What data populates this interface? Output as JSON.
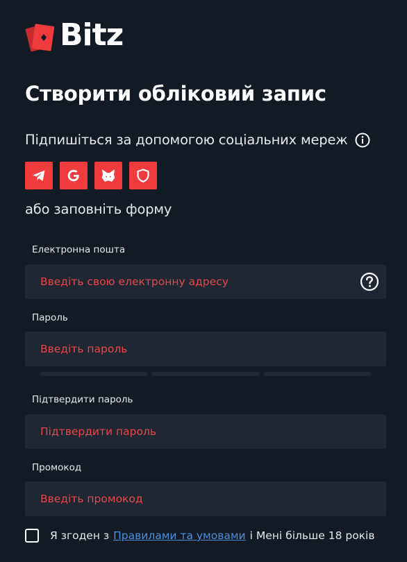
{
  "brand": {
    "name": "Bitz",
    "accent": "#ef3a3e",
    "background": "#121a23",
    "input_background": "#1f2733",
    "placeholder_color": "#e8454a",
    "link_color": "#4a90e2"
  },
  "page": {
    "title": "Створити обліковий запис",
    "social_label": "Підпишіться за допомогою соціальних мереж",
    "or_label": "або заповніть форму"
  },
  "social": [
    {
      "icon": "telegram-icon"
    },
    {
      "icon": "google-icon"
    },
    {
      "icon": "metamask-icon"
    },
    {
      "icon": "shield-icon"
    }
  ],
  "form": {
    "email": {
      "label": "Електронна пошта",
      "placeholder": "Введіть свою електронну адресу",
      "value": ""
    },
    "password": {
      "label": "Пароль",
      "placeholder": "Введіть пароль",
      "value": "",
      "strength_segments_filled": 0,
      "strength_segments_total": 3
    },
    "confirm_password": {
      "label": "Підтвердити пароль",
      "placeholder": "Підтвердити пароль",
      "value": ""
    },
    "promo": {
      "label": "Промокод",
      "placeholder": "Введіть промокод",
      "value": ""
    }
  },
  "agreement": {
    "checked": false,
    "prefix": "Я згоден з",
    "link": "Правилами та умовами",
    "suffix": "і Мені більше 18 років"
  }
}
